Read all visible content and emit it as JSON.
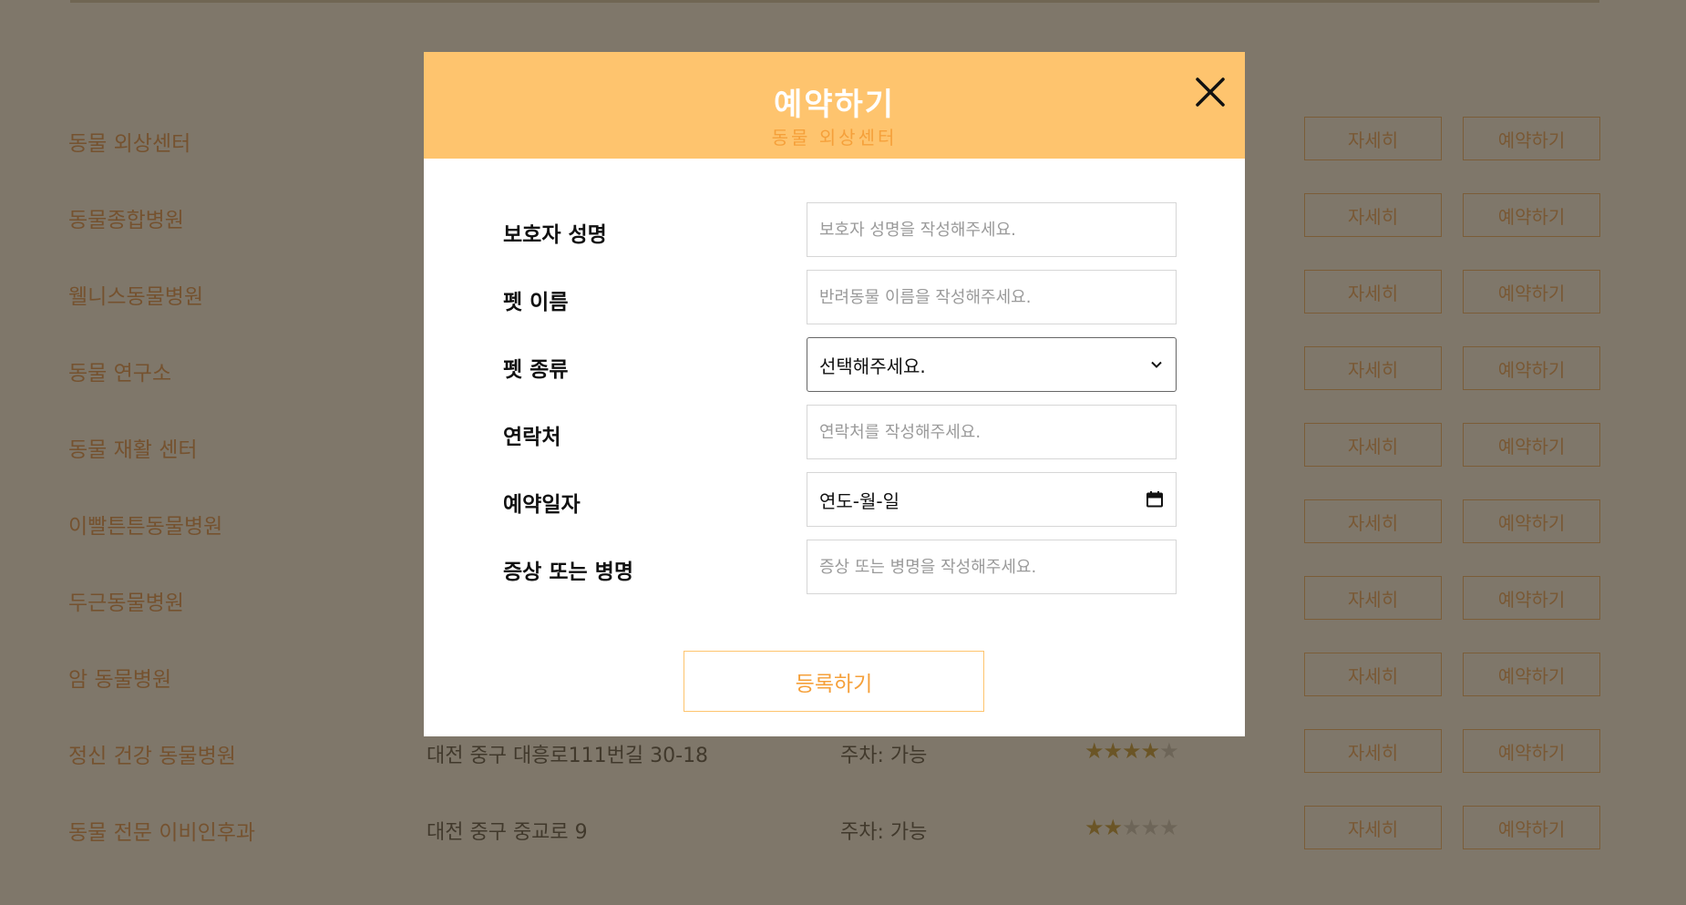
{
  "hospitals": [
    {
      "name": "동물 외상센터",
      "address": "",
      "parking": "",
      "rating": 0,
      "detail_label": "자세히",
      "reserve_label": "예약하기"
    },
    {
      "name": "동물종합병원",
      "address": "",
      "parking": "",
      "rating": 0,
      "detail_label": "자세히",
      "reserve_label": "예약하기"
    },
    {
      "name": "웰니스동물병원",
      "address": "",
      "parking": "",
      "rating": 0,
      "detail_label": "자세히",
      "reserve_label": "예약하기"
    },
    {
      "name": "동물 연구소",
      "address": "",
      "parking": "",
      "rating": 0,
      "detail_label": "자세히",
      "reserve_label": "예약하기"
    },
    {
      "name": "동물 재활 센터",
      "address": "",
      "parking": "",
      "rating": 0,
      "detail_label": "자세히",
      "reserve_label": "예약하기"
    },
    {
      "name": "이빨튼튼동물병원",
      "address": "",
      "parking": "",
      "rating": 0,
      "detail_label": "자세히",
      "reserve_label": "예약하기"
    },
    {
      "name": "두근동물병원",
      "address": "",
      "parking": "",
      "rating": 0,
      "detail_label": "자세히",
      "reserve_label": "예약하기"
    },
    {
      "name": "암 동물병원",
      "address": "",
      "parking": "",
      "rating": 0,
      "detail_label": "자세히",
      "reserve_label": "예약하기"
    },
    {
      "name": "정신 건강 동물병원",
      "address": "대전 중구 대흥로111번길 30-18",
      "parking": "주차: 가능",
      "rating": 4,
      "detail_label": "자세히",
      "reserve_label": "예약하기"
    },
    {
      "name": "동물 전문 이비인후과",
      "address": "대전 중구 중교로 9",
      "parking": "주차: 가능",
      "rating": 2,
      "detail_label": "자세히",
      "reserve_label": "예약하기"
    }
  ],
  "modal": {
    "title": "예약하기",
    "subtitle": "동물 외상센터",
    "fields": {
      "guardian_name": {
        "label": "보호자 성명",
        "placeholder": "보호자 성명을 작성해주세요."
      },
      "pet_name": {
        "label": "펫 이름",
        "placeholder": "반려동물 이름을 작성해주세요."
      },
      "pet_type": {
        "label": "펫 종류",
        "value": "선택해주세요."
      },
      "contact": {
        "label": "연락처",
        "placeholder": "연락처를 작성해주세요."
      },
      "reservation_date": {
        "label": "예약일자",
        "value": "연도-월-일"
      },
      "symptom": {
        "label": "증상 또는 병명",
        "placeholder": "증상 또는 병명을 작성해주세요."
      }
    },
    "submit_label": "등록하기"
  },
  "colors": {
    "accent": "#fec46e",
    "hospital_name": "#d97a2e",
    "overlay": "#4d4230"
  },
  "icons": {
    "close": "close-icon",
    "select_arrow": "chevron-down-icon",
    "date": "calendar-icon"
  }
}
